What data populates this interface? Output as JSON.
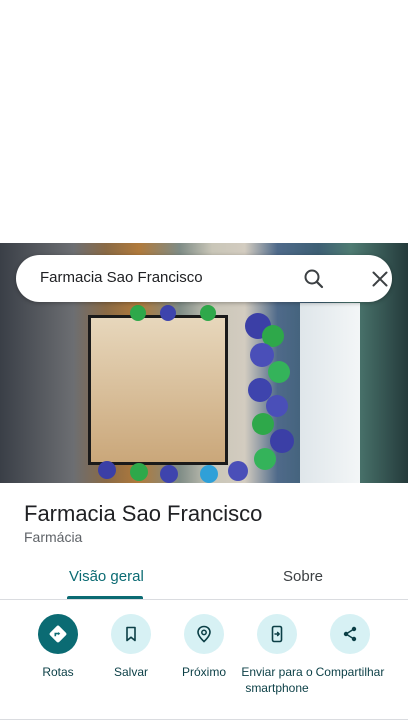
{
  "search": {
    "query": "Farmacia Sao Francisco"
  },
  "place": {
    "name": "Farmacia Sao Francisco",
    "category": "Farmácia"
  },
  "tabs": [
    {
      "label": "Visão geral",
      "active": true
    },
    {
      "label": "Sobre",
      "active": false
    }
  ],
  "actions": [
    {
      "label": "Rotas",
      "icon": "directions-icon",
      "primary": true
    },
    {
      "label": "Salvar",
      "icon": "bookmark-icon",
      "primary": false
    },
    {
      "label": "Próximo",
      "icon": "nearby-icon",
      "primary": false
    },
    {
      "label": "Enviar para o smartphone",
      "icon": "send-to-phone-icon",
      "primary": false
    },
    {
      "label": "Compartilhar",
      "icon": "share-icon",
      "primary": false
    }
  ],
  "colors": {
    "accent": "#0b6b73",
    "action_bg": "#d7f1f4",
    "text_primary": "#202124",
    "text_secondary": "#5f6368"
  }
}
